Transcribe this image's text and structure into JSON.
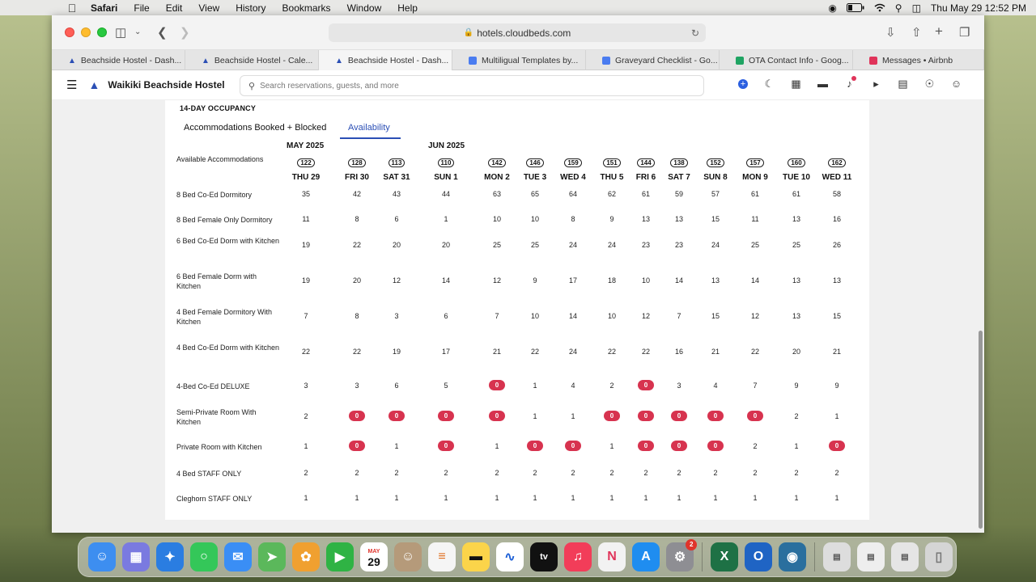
{
  "menubar": {
    "app_name": "Safari",
    "items": [
      "File",
      "Edit",
      "View",
      "History",
      "Bookmarks",
      "Window",
      "Help"
    ],
    "clock": "Thu May 29  12:52 PM"
  },
  "browser": {
    "url": "hotels.cloudbeds.com",
    "tabs": [
      {
        "label": "Beachside Hostel - Dash...",
        "icon": "bed-icon",
        "active": false
      },
      {
        "label": "Beachside Hostel - Cale...",
        "icon": "bed-icon",
        "active": false
      },
      {
        "label": "Beachside Hostel - Dash...",
        "icon": "bed-icon",
        "active": true
      },
      {
        "label": "Multiligual Templates by...",
        "icon": "docs-icon",
        "active": false
      },
      {
        "label": "Graveyard Checklist - Go...",
        "icon": "docs-icon",
        "active": false
      },
      {
        "label": "OTA Contact Info - Goog...",
        "icon": "sheets-icon",
        "active": false
      },
      {
        "label": "Messages • Airbnb",
        "icon": "airbnb-icon",
        "active": false
      }
    ]
  },
  "app": {
    "property_name": "Waikiki Beachside Hostel",
    "search_placeholder": "Search reservations, guests, and more"
  },
  "occupancy": {
    "title": "14-DAY OCCUPANCY",
    "tabs": [
      "Accommodations Booked + Blocked",
      "Availability"
    ],
    "active_tab": "Availability",
    "months": [
      "MAY 2025",
      "JUN 2025"
    ],
    "available_label": "Available Accommodations",
    "days": [
      {
        "label": "THU 29",
        "total": "122"
      },
      {
        "label": "FRI 30",
        "total": "128"
      },
      {
        "label": "SAT 31",
        "total": "113"
      },
      {
        "label": "SUN 1",
        "total": "110"
      },
      {
        "label": "MON 2",
        "total": "142"
      },
      {
        "label": "TUE 3",
        "total": "146"
      },
      {
        "label": "WED 4",
        "total": "159"
      },
      {
        "label": "THU 5",
        "total": "151"
      },
      {
        "label": "FRI 6",
        "total": "144"
      },
      {
        "label": "SAT 7",
        "total": "138"
      },
      {
        "label": "SUN 8",
        "total": "152"
      },
      {
        "label": "MON 9",
        "total": "157"
      },
      {
        "label": "TUE 10",
        "total": "160"
      },
      {
        "label": "WED 11",
        "total": "162"
      }
    ],
    "rows": [
      {
        "name": "8 Bed Co-Ed Dormitory",
        "values": [
          "35",
          "42",
          "43",
          "44",
          "63",
          "65",
          "64",
          "62",
          "61",
          "59",
          "57",
          "61",
          "61",
          "58"
        ]
      },
      {
        "name": "8 Bed Female Only Dormitory",
        "values": [
          "11",
          "8",
          "6",
          "1",
          "10",
          "10",
          "8",
          "9",
          "13",
          "13",
          "15",
          "11",
          "13",
          "16"
        ]
      },
      {
        "name": "6 Bed Co-Ed Dorm with Kitchen",
        "values": [
          "19",
          "22",
          "20",
          "20",
          "25",
          "25",
          "24",
          "24",
          "23",
          "23",
          "24",
          "25",
          "25",
          "26"
        ]
      },
      {
        "name": "6 Bed Female Dorm with Kitchen",
        "values": [
          "19",
          "20",
          "12",
          "14",
          "12",
          "9",
          "17",
          "18",
          "10",
          "14",
          "13",
          "14",
          "13",
          "13"
        ]
      },
      {
        "name": "4 Bed Female Dormitory With Kitchen",
        "values": [
          "7",
          "8",
          "3",
          "6",
          "7",
          "10",
          "14",
          "10",
          "12",
          "7",
          "15",
          "12",
          "13",
          "15"
        ]
      },
      {
        "name": "4 Bed Co-Ed Dorm with Kitchen",
        "values": [
          "22",
          "22",
          "19",
          "17",
          "21",
          "22",
          "24",
          "22",
          "22",
          "16",
          "21",
          "22",
          "20",
          "21"
        ]
      },
      {
        "name": "4-Bed Co-Ed DELUXE",
        "values": [
          "3",
          "3",
          "6",
          "5",
          "0",
          "1",
          "4",
          "2",
          "0",
          "3",
          "4",
          "7",
          "9",
          "9"
        ]
      },
      {
        "name": "Semi-Private Room With Kitchen",
        "values": [
          "2",
          "0",
          "0",
          "0",
          "0",
          "1",
          "1",
          "0",
          "0",
          "0",
          "0",
          "0",
          "2",
          "1"
        ]
      },
      {
        "name": "Private Room with Kitchen",
        "values": [
          "1",
          "0",
          "1",
          "0",
          "1",
          "0",
          "0",
          "1",
          "0",
          "0",
          "0",
          "2",
          "1",
          "0"
        ]
      },
      {
        "name": "4 Bed STAFF ONLY",
        "values": [
          "2",
          "2",
          "2",
          "2",
          "2",
          "2",
          "2",
          "2",
          "2",
          "2",
          "2",
          "2",
          "2",
          "2"
        ]
      },
      {
        "name": "Cleghorn STAFF ONLY",
        "values": [
          "1",
          "1",
          "1",
          "1",
          "1",
          "1",
          "1",
          "1",
          "1",
          "1",
          "1",
          "1",
          "1",
          "1"
        ]
      }
    ]
  },
  "dock": {
    "calendar_month": "MAY",
    "calendar_day": "29",
    "system_settings_badge": "2",
    "appletv_label": "tv",
    "excel_label": "X",
    "outlook_label": "O"
  },
  "colors": {
    "accent": "#2b4fb5",
    "zero_badge": "#d7334f"
  }
}
